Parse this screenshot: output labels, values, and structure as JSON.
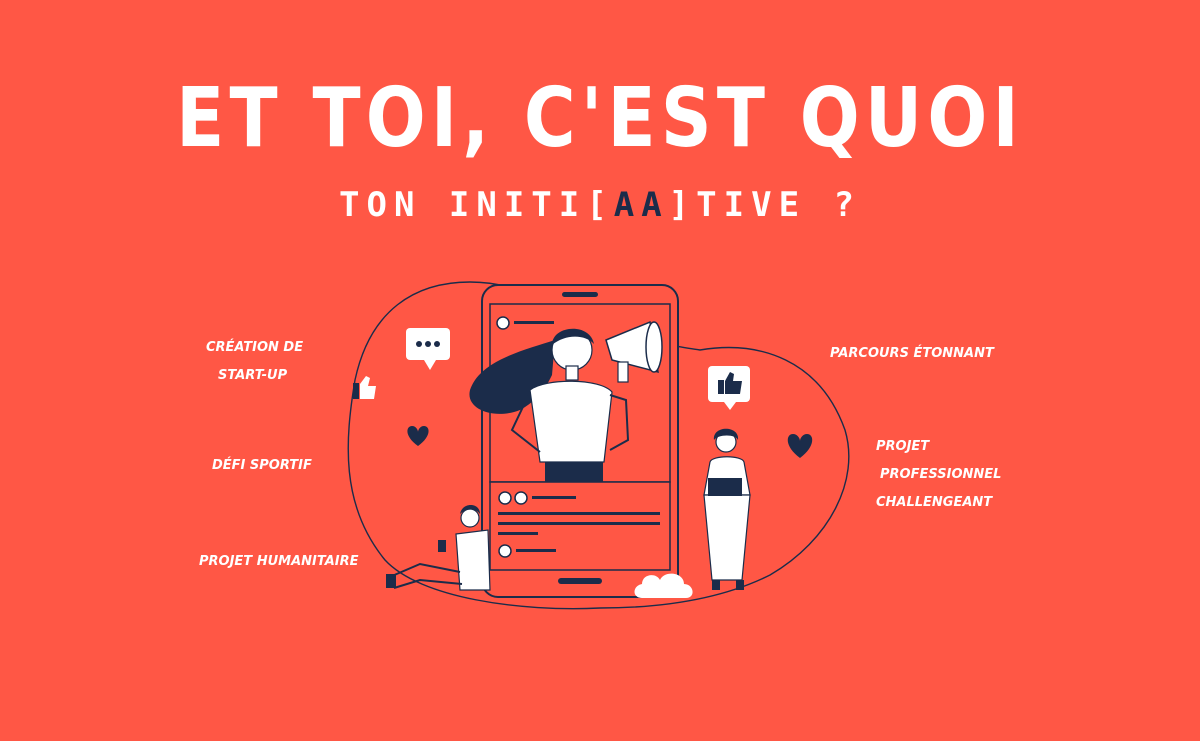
{
  "title": "ET TOI, C'EST QUOI",
  "subtitle": {
    "before": "TON INITI",
    "bracket_open": "[",
    "highlight": "AA",
    "bracket_close": "]",
    "after": "TIVE ?"
  },
  "labels_left": {
    "startup_line1": "CRÉATION DE",
    "startup_line2": "START-UP",
    "sport": "DÉFI SPORTIF",
    "humanitarian": "PROJET HUMANITAIRE"
  },
  "labels_right": {
    "parcours": "PARCOURS ÉTONNANT",
    "pro_line1": "PROJET",
    "pro_line2": "PROFESSIONNEL",
    "pro_line3": "CHALLENGEANT"
  },
  "colors": {
    "background": "#FF5745",
    "text": "#FFFFFF",
    "navy": "#1B2C4A",
    "highlight": "#1B2C4A"
  },
  "icons": [
    "chat-bubble-icon",
    "thumbs-up-icon",
    "heart-icon",
    "megaphone-icon",
    "cloud-icon",
    "smartphone-icon"
  ]
}
